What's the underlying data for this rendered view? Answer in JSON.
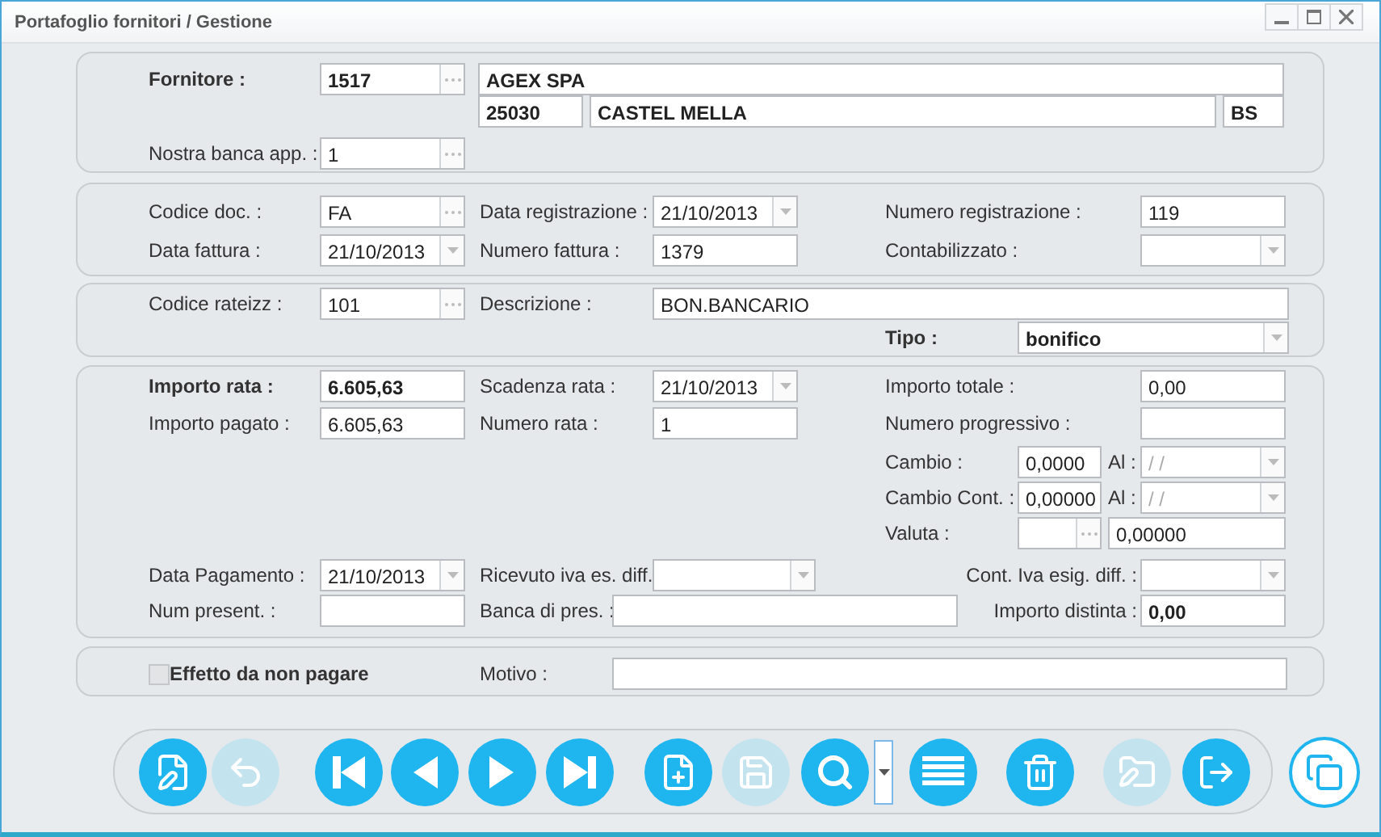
{
  "window": {
    "title": "Portafoglio fornitori / Gestione"
  },
  "supplier": {
    "label": "Fornitore :",
    "code": "1517",
    "name": "AGEX SPA",
    "zip": "25030",
    "city": "CASTEL MELLA",
    "province": "BS",
    "bank_label": "Nostra banca app. :",
    "bank": "1"
  },
  "document": {
    "doc_code": {
      "label": "Codice doc. :",
      "value": "FA"
    },
    "registration_date": {
      "label": "Data registrazione :",
      "value": "21/10/2013"
    },
    "registration_number": {
      "label": "Numero registrazione :",
      "value": "119"
    },
    "invoice_date": {
      "label": "Data fattura :",
      "value": "21/10/2013"
    },
    "invoice_number": {
      "label": "Numero fattura :",
      "value": "1379"
    },
    "posted": {
      "label": "Contabilizzato :"
    }
  },
  "plan": {
    "code": {
      "label": "Codice rateizz :",
      "value": "101"
    },
    "description": {
      "label": "Descrizione :",
      "value": "BON.BANCARIO"
    },
    "type": {
      "label": "Tipo :",
      "value": "bonifico"
    }
  },
  "installment": {
    "amount": {
      "label": "Importo rata :",
      "value": "6.605,63"
    },
    "due_date": {
      "label": "Scadenza rata :",
      "value": "21/10/2013"
    },
    "total": {
      "label": "Importo totale :",
      "value": "0,00"
    },
    "paid": {
      "label": "Importo pagato :",
      "value": "6.605,63"
    },
    "number": {
      "label": "Numero rata :",
      "value": "1"
    },
    "progressive": {
      "label": "Numero progressivo :"
    },
    "exchange": {
      "label": "Cambio :",
      "value": "0,0000",
      "to_label": "Al :",
      "to_placeholder": "/  /"
    },
    "accounting_exchange": {
      "label": "Cambio Cont. :",
      "value": "0,00000",
      "to_label": "Al :",
      "to_placeholder": "/  /"
    },
    "currency": {
      "label": "Valuta :",
      "value": "0,00000"
    },
    "payment_date": {
      "label": "Data Pagamento :",
      "value": "21/10/2013"
    },
    "vat_received": {
      "label": "Ricevuto iva es. diff."
    },
    "vat_due": {
      "label": "Cont. Iva esig. diff. :"
    },
    "presentation_number": {
      "label": "Num present. :"
    },
    "presentation_bank": {
      "label": "Banca di pres. :"
    },
    "batch_amount": {
      "label": "Importo distinta :",
      "value": "0,00"
    }
  },
  "unpaid": {
    "checkbox": {
      "label": "Effetto da non pagare",
      "checked": false
    },
    "reason": {
      "label": "Motivo :"
    }
  },
  "toolbar": [
    {
      "kind": "edit",
      "disabled": false
    },
    {
      "kind": "undo",
      "disabled": true
    },
    {
      "kind": "first",
      "disabled": false
    },
    {
      "kind": "prev",
      "disabled": false
    },
    {
      "kind": "next",
      "disabled": false
    },
    {
      "kind": "last",
      "disabled": false
    },
    {
      "kind": "new",
      "disabled": false
    },
    {
      "kind": "save",
      "disabled": true
    },
    {
      "kind": "search",
      "disabled": false
    },
    {
      "kind": "dropdown",
      "disabled": false
    },
    {
      "kind": "list",
      "disabled": false
    },
    {
      "kind": "delete",
      "disabled": false
    },
    {
      "kind": "export",
      "disabled": true
    },
    {
      "kind": "exit",
      "disabled": false
    }
  ],
  "side_button": {
    "kind": "copy",
    "disabled": false
  }
}
